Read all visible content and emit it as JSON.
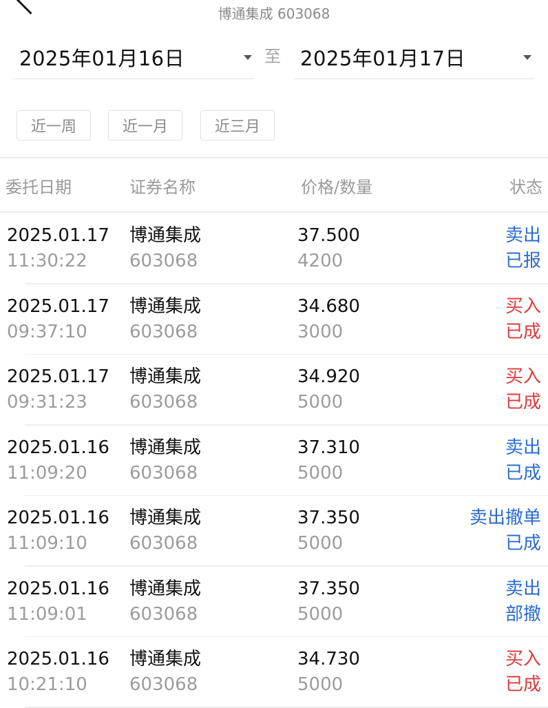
{
  "header": {
    "subtitle": "博通集成 603068"
  },
  "date_range": {
    "start": "2025年01月16日",
    "separator": "至",
    "end": "2025年01月17日"
  },
  "quick_filters": [
    "近一周",
    "近一月",
    "近三月"
  ],
  "table": {
    "columns": [
      "委托日期",
      "证券名称",
      "价格/数量",
      "状态"
    ],
    "rows": [
      {
        "date": "2025.01.17",
        "time": "11:30:22",
        "name": "博通集成",
        "code": "603068",
        "price": "37.500",
        "qty": "4200",
        "direction": "卖出",
        "status": "已报",
        "color": "#2a6bd1"
      },
      {
        "date": "2025.01.17",
        "time": "09:37:10",
        "name": "博通集成",
        "code": "603068",
        "price": "34.680",
        "qty": "3000",
        "direction": "买入",
        "status": "已成",
        "color": "#de3a3a"
      },
      {
        "date": "2025.01.17",
        "time": "09:31:23",
        "name": "博通集成",
        "code": "603068",
        "price": "34.920",
        "qty": "5000",
        "direction": "买入",
        "status": "已成",
        "color": "#de3a3a"
      },
      {
        "date": "2025.01.16",
        "time": "11:09:20",
        "name": "博通集成",
        "code": "603068",
        "price": "37.310",
        "qty": "5000",
        "direction": "卖出",
        "status": "已成",
        "color": "#2a6bd1"
      },
      {
        "date": "2025.01.16",
        "time": "11:09:10",
        "name": "博通集成",
        "code": "603068",
        "price": "37.350",
        "qty": "5000",
        "direction": "卖出撤单",
        "status": "已成",
        "color": "#2a6bd1"
      },
      {
        "date": "2025.01.16",
        "time": "11:09:01",
        "name": "博通集成",
        "code": "603068",
        "price": "37.350",
        "qty": "5000",
        "direction": "卖出",
        "status": "部撤",
        "color": "#2a6bd1"
      },
      {
        "date": "2025.01.16",
        "time": "10:21:10",
        "name": "博通集成",
        "code": "603068",
        "price": "34.730",
        "qty": "5000",
        "direction": "买入",
        "status": "已成",
        "color": "#de3a3a"
      }
    ]
  }
}
